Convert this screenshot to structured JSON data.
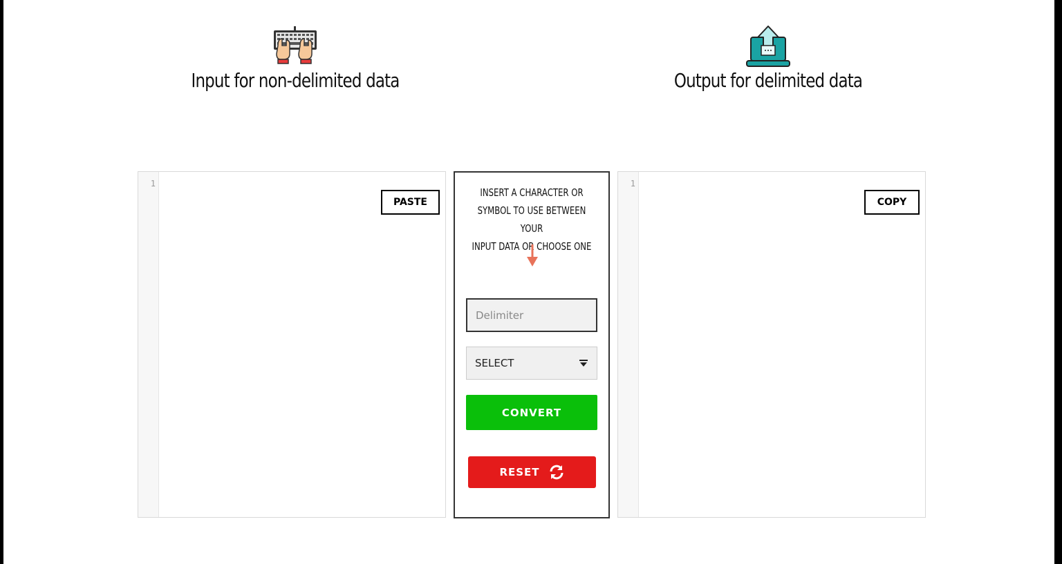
{
  "header": {
    "input_title": "Input for non-delimited data",
    "output_title": "Output for delimited data",
    "input_icon": "keyboard-typing-icon",
    "output_icon": "laptop-upload-icon"
  },
  "input_editor": {
    "line_number": "1",
    "paste_label": "PASTE"
  },
  "output_editor": {
    "line_number": "1",
    "copy_label": "COPY"
  },
  "middle": {
    "instructions": "INSERT A CHARACTER OR\nSYMBOL TO USE BETWEEN YOUR\nINPUT DATA OR CHOOSE ONE",
    "arrow_icon": "arrow-down-icon",
    "delimiter_placeholder": "Delimiter",
    "delimiter_value": "",
    "select_label": "SELECT",
    "convert_label": "CONVERT",
    "reset_label": "RESET",
    "reset_icon": "refresh-icon"
  },
  "colors": {
    "convert": "#0abf0a",
    "reset": "#e41b1b",
    "arrow": "#e8735a",
    "icon_teal": "#1aa3a3"
  }
}
